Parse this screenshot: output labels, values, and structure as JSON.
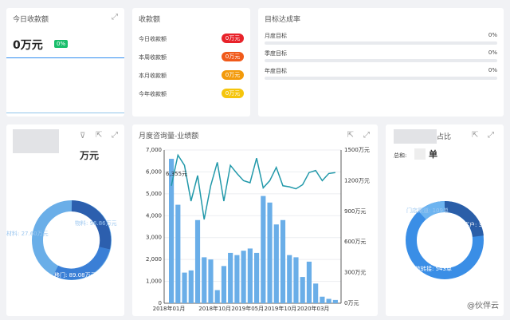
{
  "card1": {
    "title": "今日收款额",
    "value": "0万元",
    "badge": "0%"
  },
  "card2": {
    "title": "收款额",
    "rows": [
      {
        "label": "今日收款额",
        "value": "0万元",
        "color": "#e8222a"
      },
      {
        "label": "本周收款额",
        "value": "0万元",
        "color": "#f05a1a"
      },
      {
        "label": "本月收款额",
        "value": "0万元",
        "color": "#f39a0a"
      },
      {
        "label": "今年收款额",
        "value": "0万元",
        "color": "#f5c50c"
      }
    ]
  },
  "card3": {
    "title": "目标达成率",
    "goals": [
      {
        "label": "月度目标",
        "value": "0%",
        "progress": 0
      },
      {
        "label": "季度目标",
        "value": "0%",
        "progress": 0
      },
      {
        "label": "年度目标",
        "value": "0%",
        "progress": 0
      }
    ]
  },
  "card4": {
    "title": "万元",
    "labels": {
      "top": "物料: 96.86万元",
      "left": "材料: 27.60万元",
      "bottom": "移门: 89.08万元"
    }
  },
  "card5": {
    "title": "月度咨询量-业绩额",
    "chart_data": {
      "type": "bar",
      "title": "月度咨询量-业绩额",
      "y_left_ticks": [
        "0",
        "1,000",
        "2,000",
        "3,000",
        "4,000",
        "5,000",
        "6,000",
        "7,000"
      ],
      "y_right_ticks": [
        "0万元",
        "300万元",
        "600万元",
        "900万元",
        "1200万元",
        "1500万元"
      ],
      "x_ticks": [
        "2018年01月",
        "2018年10月",
        "2019年05月",
        "2019年10月",
        "2020年03月"
      ],
      "ylim_left": [
        0,
        7000
      ],
      "ylim_right": [
        0,
        1500
      ],
      "bars": [
        6600,
        4500,
        1400,
        1500,
        3800,
        2100,
        2000,
        600,
        1700,
        2300,
        2200,
        2400,
        2500,
        2300,
        4900,
        4600,
        3600,
        3800,
        2200,
        2100,
        1200,
        1900,
        900,
        300,
        200,
        150
      ],
      "line": [
        1150,
        1450,
        1350,
        1000,
        1250,
        820,
        1150,
        1380,
        1000,
        1350,
        1270,
        1200,
        1180,
        1420,
        1130,
        1200,
        1330,
        1150,
        1140,
        1120,
        1160,
        1280,
        1300,
        1200,
        1270,
        1280
      ],
      "annotation_top": "6,355元"
    }
  },
  "card6": {
    "title": "占比",
    "total_label": "总和:",
    "total_unit": "单",
    "labels": {
      "top": "门店渠道: 109单",
      "right": "网络客户: 325单",
      "bottom": "微信转接: 543单"
    }
  },
  "watermark": "@伙伴云"
}
